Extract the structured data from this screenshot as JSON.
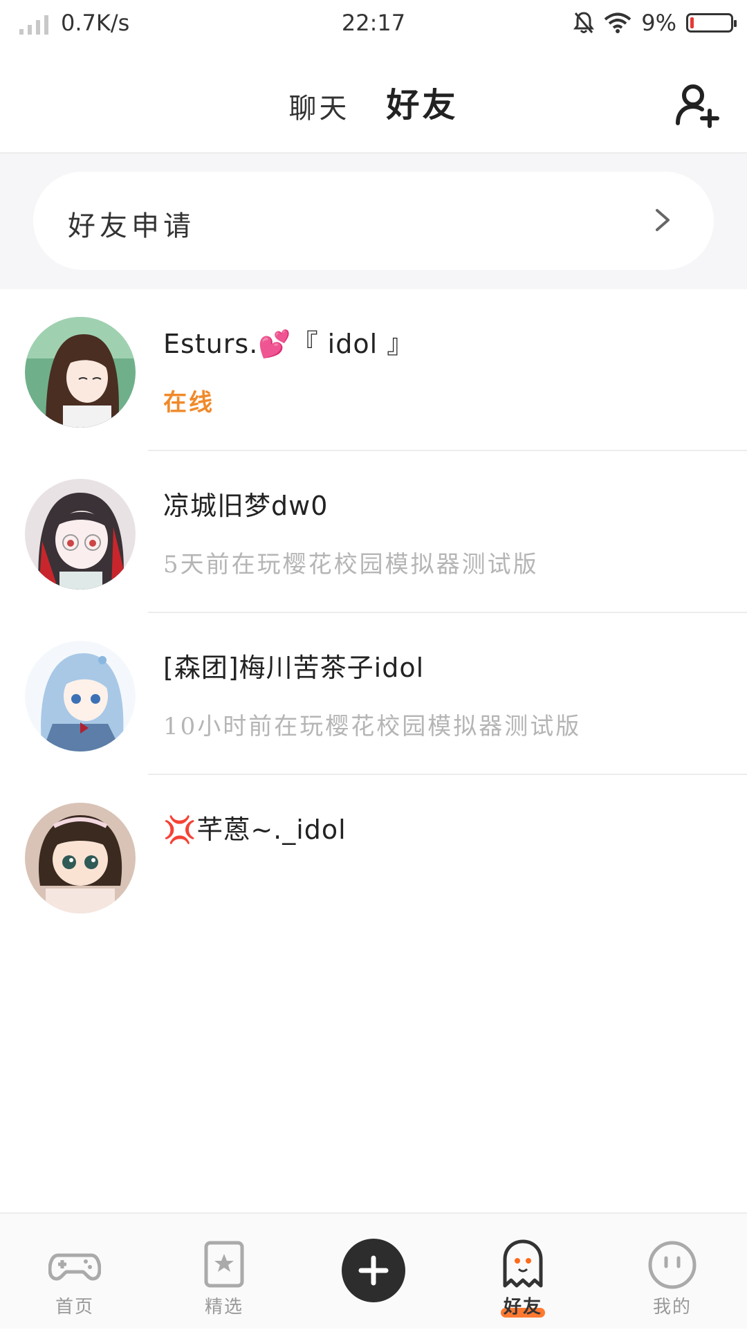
{
  "status": {
    "net_speed": "0.7K/s",
    "time": "22:17",
    "battery": "9%",
    "battery_level": 0.09
  },
  "header": {
    "tabs": [
      {
        "label": "聊天",
        "active": false
      },
      {
        "label": "好友",
        "active": true
      }
    ],
    "add_friend_icon": "add-user-icon"
  },
  "friend_requests": {
    "label": "好友申请"
  },
  "friends": [
    {
      "name": "Esturs.💕『 idol 』",
      "status": "在线",
      "online": true
    },
    {
      "name": "凉城旧梦dw0",
      "status": "5天前在玩樱花校园模拟器测试版",
      "online": false
    },
    {
      "name": "[森团]梅川苦茶子idol",
      "status": "10小时前在玩樱花校园模拟器测试版",
      "online": false
    },
    {
      "name": "💢芊蒽~._idol",
      "status": "",
      "online": false
    }
  ],
  "bottom_nav": [
    {
      "label": "首页",
      "icon": "gamepad-icon",
      "active": false
    },
    {
      "label": "精选",
      "icon": "star-bookmark-icon",
      "active": false
    },
    {
      "label": "",
      "icon": "plus-icon",
      "active": false
    },
    {
      "label": "好友",
      "icon": "ghost-icon",
      "active": true
    },
    {
      "label": "我的",
      "icon": "smiley-icon",
      "active": false
    }
  ],
  "colors": {
    "accent": "#ff6a1a",
    "online": "#f08a2a"
  }
}
